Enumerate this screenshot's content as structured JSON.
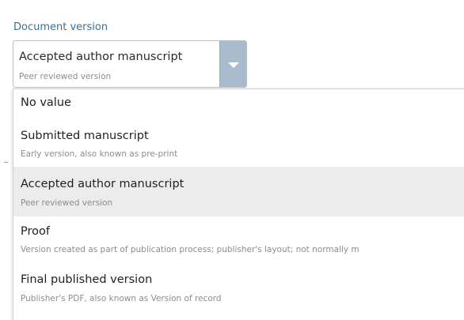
{
  "field": {
    "label": "Document version"
  },
  "select": {
    "value": "Accepted author manuscript",
    "value_desc": "Peer reviewed version"
  },
  "menu": {
    "options": [
      {
        "label": "No value",
        "desc": ""
      },
      {
        "label": "Submitted manuscript",
        "desc": "Early version, also known as pre-print"
      },
      {
        "label": "Accepted author manuscript",
        "desc": "Peer reviewed version",
        "selected": true
      },
      {
        "label": "Proof",
        "desc": "Version created as part of publication process; publisher's layout; not normally m"
      },
      {
        "label": "Final published version",
        "desc": "Publisher's PDF, also known as Version of record"
      }
    ]
  },
  "icons": {
    "dropdown": "chevron-down-icon"
  },
  "colors": {
    "label": "#3a6f9a",
    "arrow_button": "#a9bccd",
    "selected_row": "#ececec"
  }
}
